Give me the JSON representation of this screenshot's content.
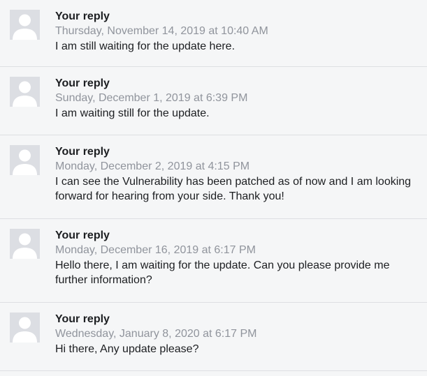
{
  "replies": [
    {
      "author": "Your reply",
      "timestamp": "Thursday, November 14, 2019 at 10:40 AM",
      "message": "I am still waiting for the update here.",
      "avatar_icon": "default-person-icon"
    },
    {
      "author": "Your reply",
      "timestamp": "Sunday, December 1, 2019 at 6:39 PM",
      "message": "I am waiting still for the update.",
      "avatar_icon": "default-person-icon"
    },
    {
      "author": "Your reply",
      "timestamp": "Monday, December 2, 2019 at 4:15 PM",
      "message": "I can see the Vulnerability has been patched as of now and I am looking forward for hearing from your side. Thank you!",
      "avatar_icon": "default-person-icon"
    },
    {
      "author": "Your reply",
      "timestamp": "Monday, December 16, 2019 at 6:17 PM",
      "message": "Hello there, I am waiting for the update. Can you please provide me further information?",
      "avatar_icon": "default-person-icon"
    },
    {
      "author": "Your reply",
      "timestamp": "Wednesday, January 8, 2020 at 6:17 PM",
      "message": "Hi there, Any update please?",
      "avatar_icon": "default-person-icon"
    }
  ],
  "colors": {
    "background": "#f5f6f7",
    "divider": "#dddfe2",
    "timestamp": "#90949c",
    "text": "#1c1e21",
    "avatar_bg": "#dcdee3",
    "avatar_fg": "#ffffff"
  }
}
